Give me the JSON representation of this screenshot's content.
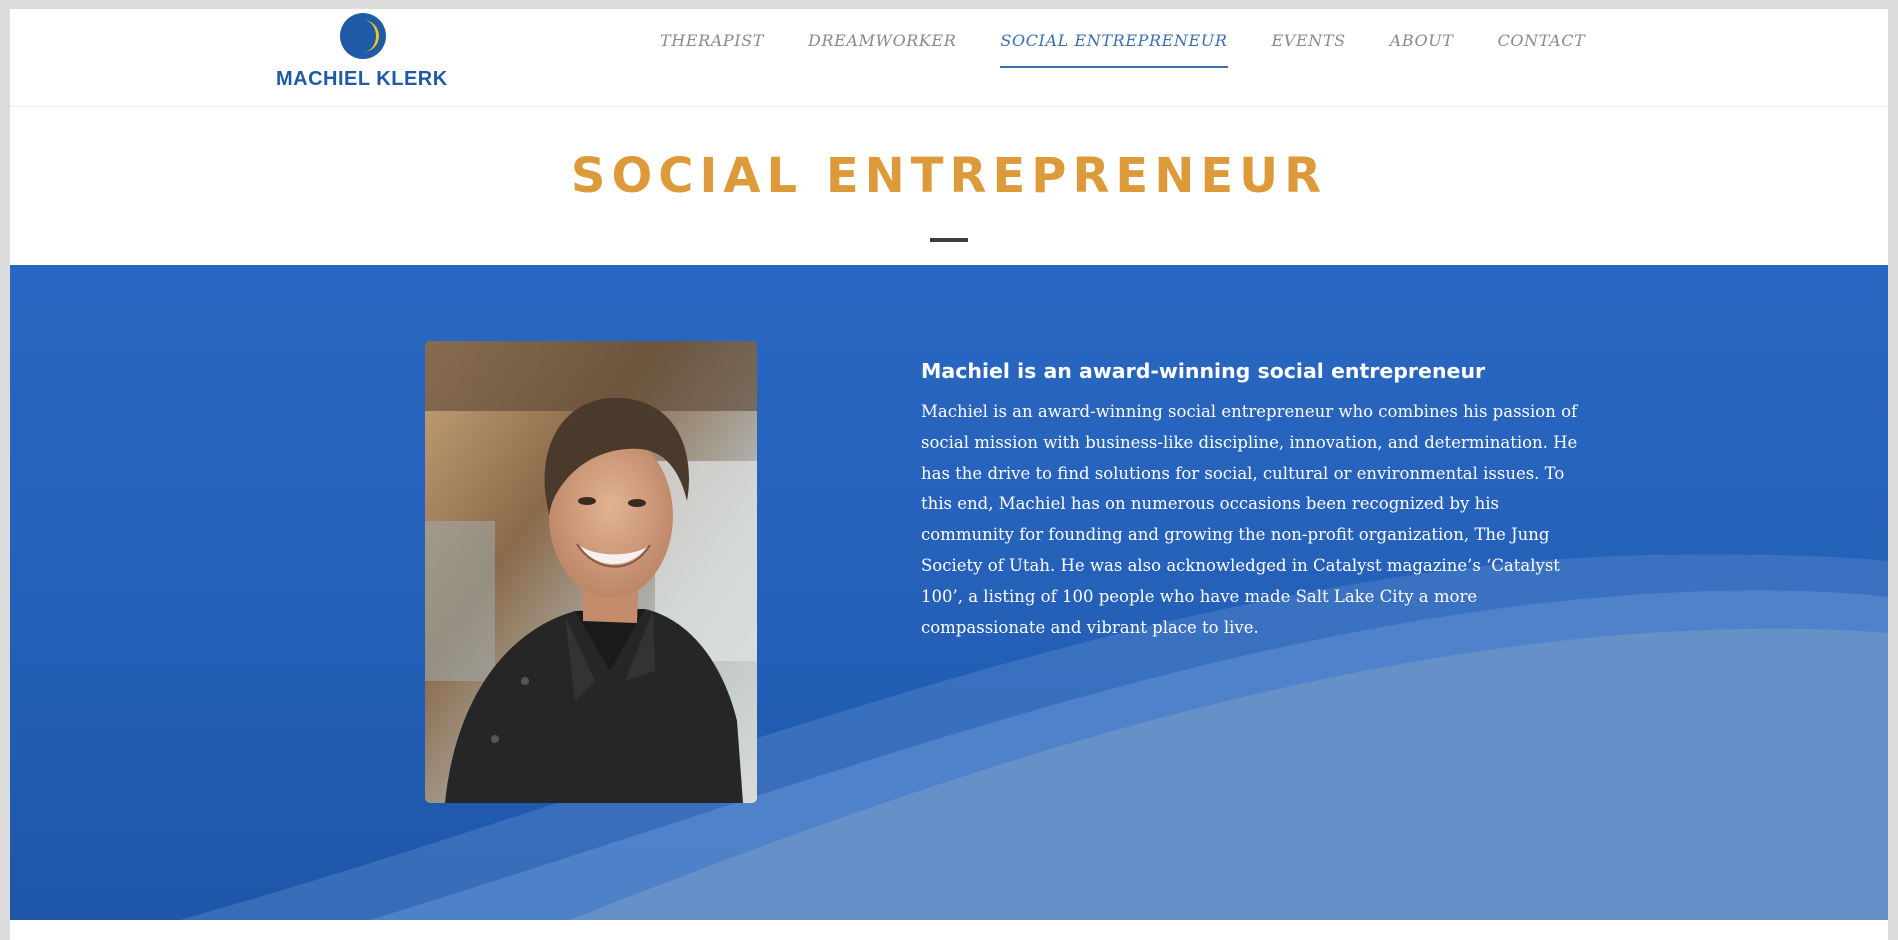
{
  "brand": {
    "name": "MACHIEL KLERK",
    "logo_icon": "crescent-moon-icon",
    "colors": {
      "primary_blue": "#1f5aa6",
      "accent_gold": "#dd9a3b",
      "section_blue": "#2a67c2"
    }
  },
  "nav": {
    "items": [
      {
        "label": "THERAPIST",
        "active": false
      },
      {
        "label": "DREAMWORKER",
        "active": false
      },
      {
        "label": "SOCIAL ENTREPRENEUR",
        "active": true
      },
      {
        "label": "EVENTS",
        "active": false
      },
      {
        "label": "ABOUT",
        "active": false
      },
      {
        "label": "CONTACT",
        "active": false
      }
    ]
  },
  "page": {
    "title": "SOCIAL ENTREPRENEUR"
  },
  "feature": {
    "image_icon": "portrait-photo",
    "heading": "Machiel is an award-winning social entrepreneur",
    "body": "Machiel is an award-winning social entrepreneur who combines his passion of social mission with business-like discipline, innovation, and determination. He has the drive to find solutions for social, cultural or environmental issues. To this end, Machiel has on numerous occasions been recognized by his community for founding and growing the non-profit organization, The Jung Society of Utah. He was also acknowledged in Catalyst magazine’s ‘Catalyst 100’, a listing of 100 people who have made Salt Lake City a more compassionate and vibrant place to live."
  }
}
